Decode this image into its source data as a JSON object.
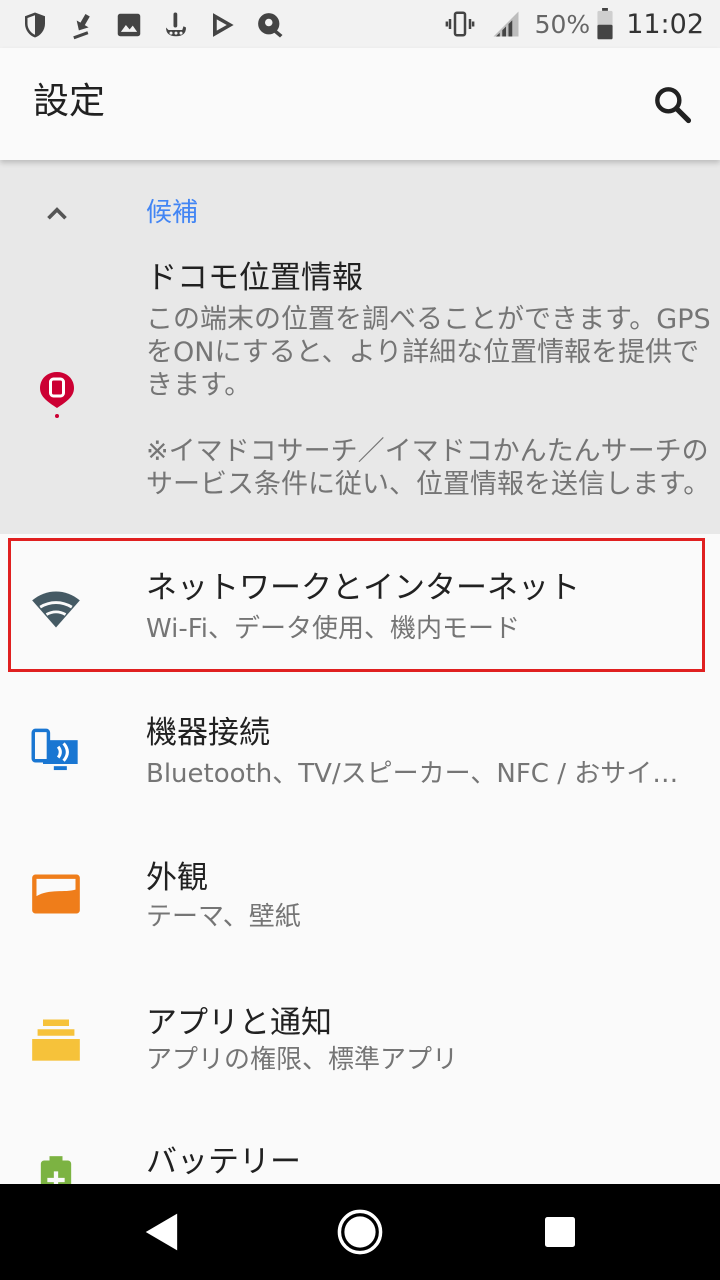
{
  "status_bar": {
    "battery_percent": "50%",
    "time": "11:02"
  },
  "app_bar": {
    "title": "設定"
  },
  "suggestion": {
    "header": "候補",
    "title": "ドコモ位置情報",
    "description": "この端末の位置を調べることができます。GPSをONにすると、より詳細な位置情報を提供できます。\n\n※イマドコサーチ／イマドコかんたんサーチのサービス条件に従い、位置情報を送信します。"
  },
  "settings": [
    {
      "title": "ネットワークとインターネット",
      "subtitle": "Wi-Fi、データ使用、機内モード"
    },
    {
      "title": "機器接続",
      "subtitle": "Bluetooth、TV/スピーカー、NFC / おサイフケータイ"
    },
    {
      "title": "外観",
      "subtitle": "テーマ、壁紙"
    },
    {
      "title": "アプリと通知",
      "subtitle": "アプリの権限、標準アプリ"
    },
    {
      "title": "バッテリー",
      "subtitle": ""
    }
  ],
  "colors": {
    "accent_blue": "#4285f4",
    "highlight_red": "#e02020",
    "docomo_red": "#cc0033",
    "network_icon": "#455a64",
    "devices_blue": "#1976d2",
    "display_orange": "#ef7d1a",
    "apps_yellow": "#f6c23a",
    "battery_green": "#7cb342"
  },
  "icons": {
    "status_left": [
      "shield-icon",
      "download-icon",
      "image-icon",
      "touch-icon",
      "play-store-icon",
      "sync-icon"
    ],
    "status_right": [
      "vibrate-icon",
      "signal-icon",
      "battery-icon"
    ],
    "search": "search-icon",
    "collapse": "chevron-up-icon",
    "suggestion": "docomo-location-icon",
    "rows": [
      "wifi-icon",
      "devices-icon",
      "display-icon",
      "apps-icon",
      "battery-icon"
    ],
    "nav": [
      "back-icon",
      "home-icon",
      "recents-icon"
    ]
  }
}
